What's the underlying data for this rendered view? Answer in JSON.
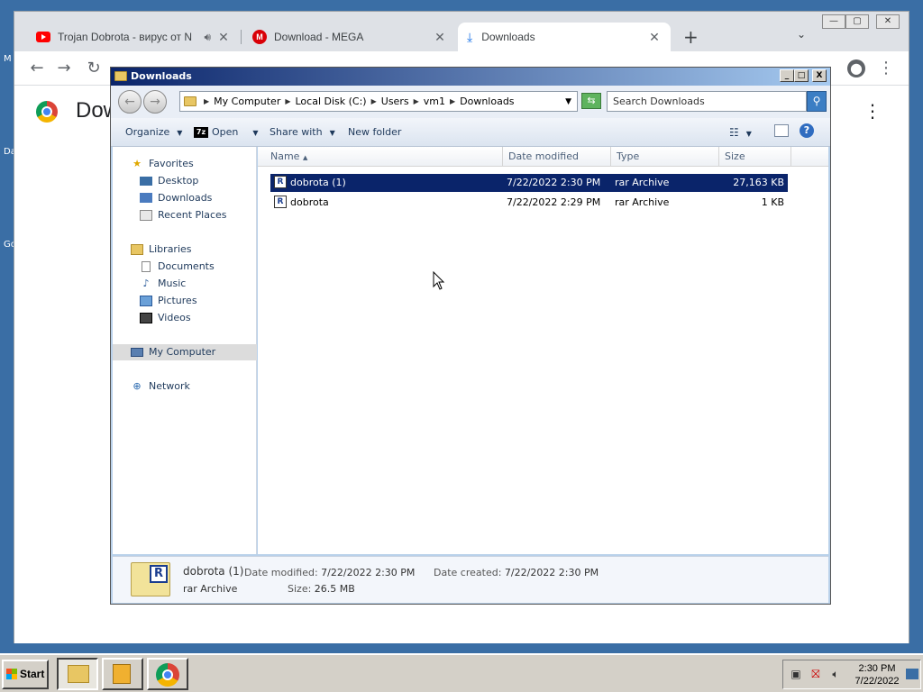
{
  "desktop": {
    "letters": [
      "M",
      "Da",
      "Go"
    ]
  },
  "browser": {
    "tabs": [
      {
        "title": "Trojan Dobrota - вирус от N",
        "icon": "youtube-icon",
        "audio": true
      },
      {
        "title": "Download - MEGA",
        "icon": "mega-icon"
      },
      {
        "title": "Downloads",
        "icon": "download-icon",
        "active": true
      }
    ],
    "new_tab": "+",
    "page_heading": "Dow",
    "window_controls": {
      "minimize": "—",
      "maximize": "▢",
      "close": "✕"
    }
  },
  "explorer": {
    "title": "Downloads",
    "title_controls": {
      "minimize": "_",
      "maximize": "□",
      "close": "X"
    },
    "address_crumbs": [
      "My Computer",
      "Local Disk (C:)",
      "Users",
      "vm1",
      "Downloads"
    ],
    "search_placeholder": "Search Downloads",
    "commands": {
      "organize": "Organize",
      "open": "Open",
      "open_badge": "7z",
      "share_with": "Share with",
      "new_folder": "New folder"
    },
    "nav": {
      "favorites": "Favorites",
      "desktop": "Desktop",
      "downloads": "Downloads",
      "recent": "Recent Places",
      "libraries": "Libraries",
      "documents": "Documents",
      "music": "Music",
      "pictures": "Pictures",
      "videos": "Videos",
      "my_computer": "My Computer",
      "network": "Network"
    },
    "columns": {
      "name": "Name",
      "date": "Date modified",
      "type": "Type",
      "size": "Size"
    },
    "files": [
      {
        "name": "dobrota (1)",
        "date": "7/22/2022 2:30 PM",
        "type": "rar Archive",
        "size": "27,163 KB",
        "selected": true
      },
      {
        "name": "dobrota",
        "date": "7/22/2022 2:29 PM",
        "type": "rar Archive",
        "size": "1 KB",
        "selected": false
      }
    ],
    "details": {
      "name": "dobrota (1)",
      "type": "rar Archive",
      "modified_label": "Date modified:",
      "modified": "7/22/2022 2:30 PM",
      "created_label": "Date created:",
      "created": "7/22/2022 2:30 PM",
      "size_label": "Size:",
      "size": "26.5 MB"
    }
  },
  "taskbar": {
    "start": "Start",
    "time": "2:30 PM",
    "date": "7/22/2022"
  }
}
